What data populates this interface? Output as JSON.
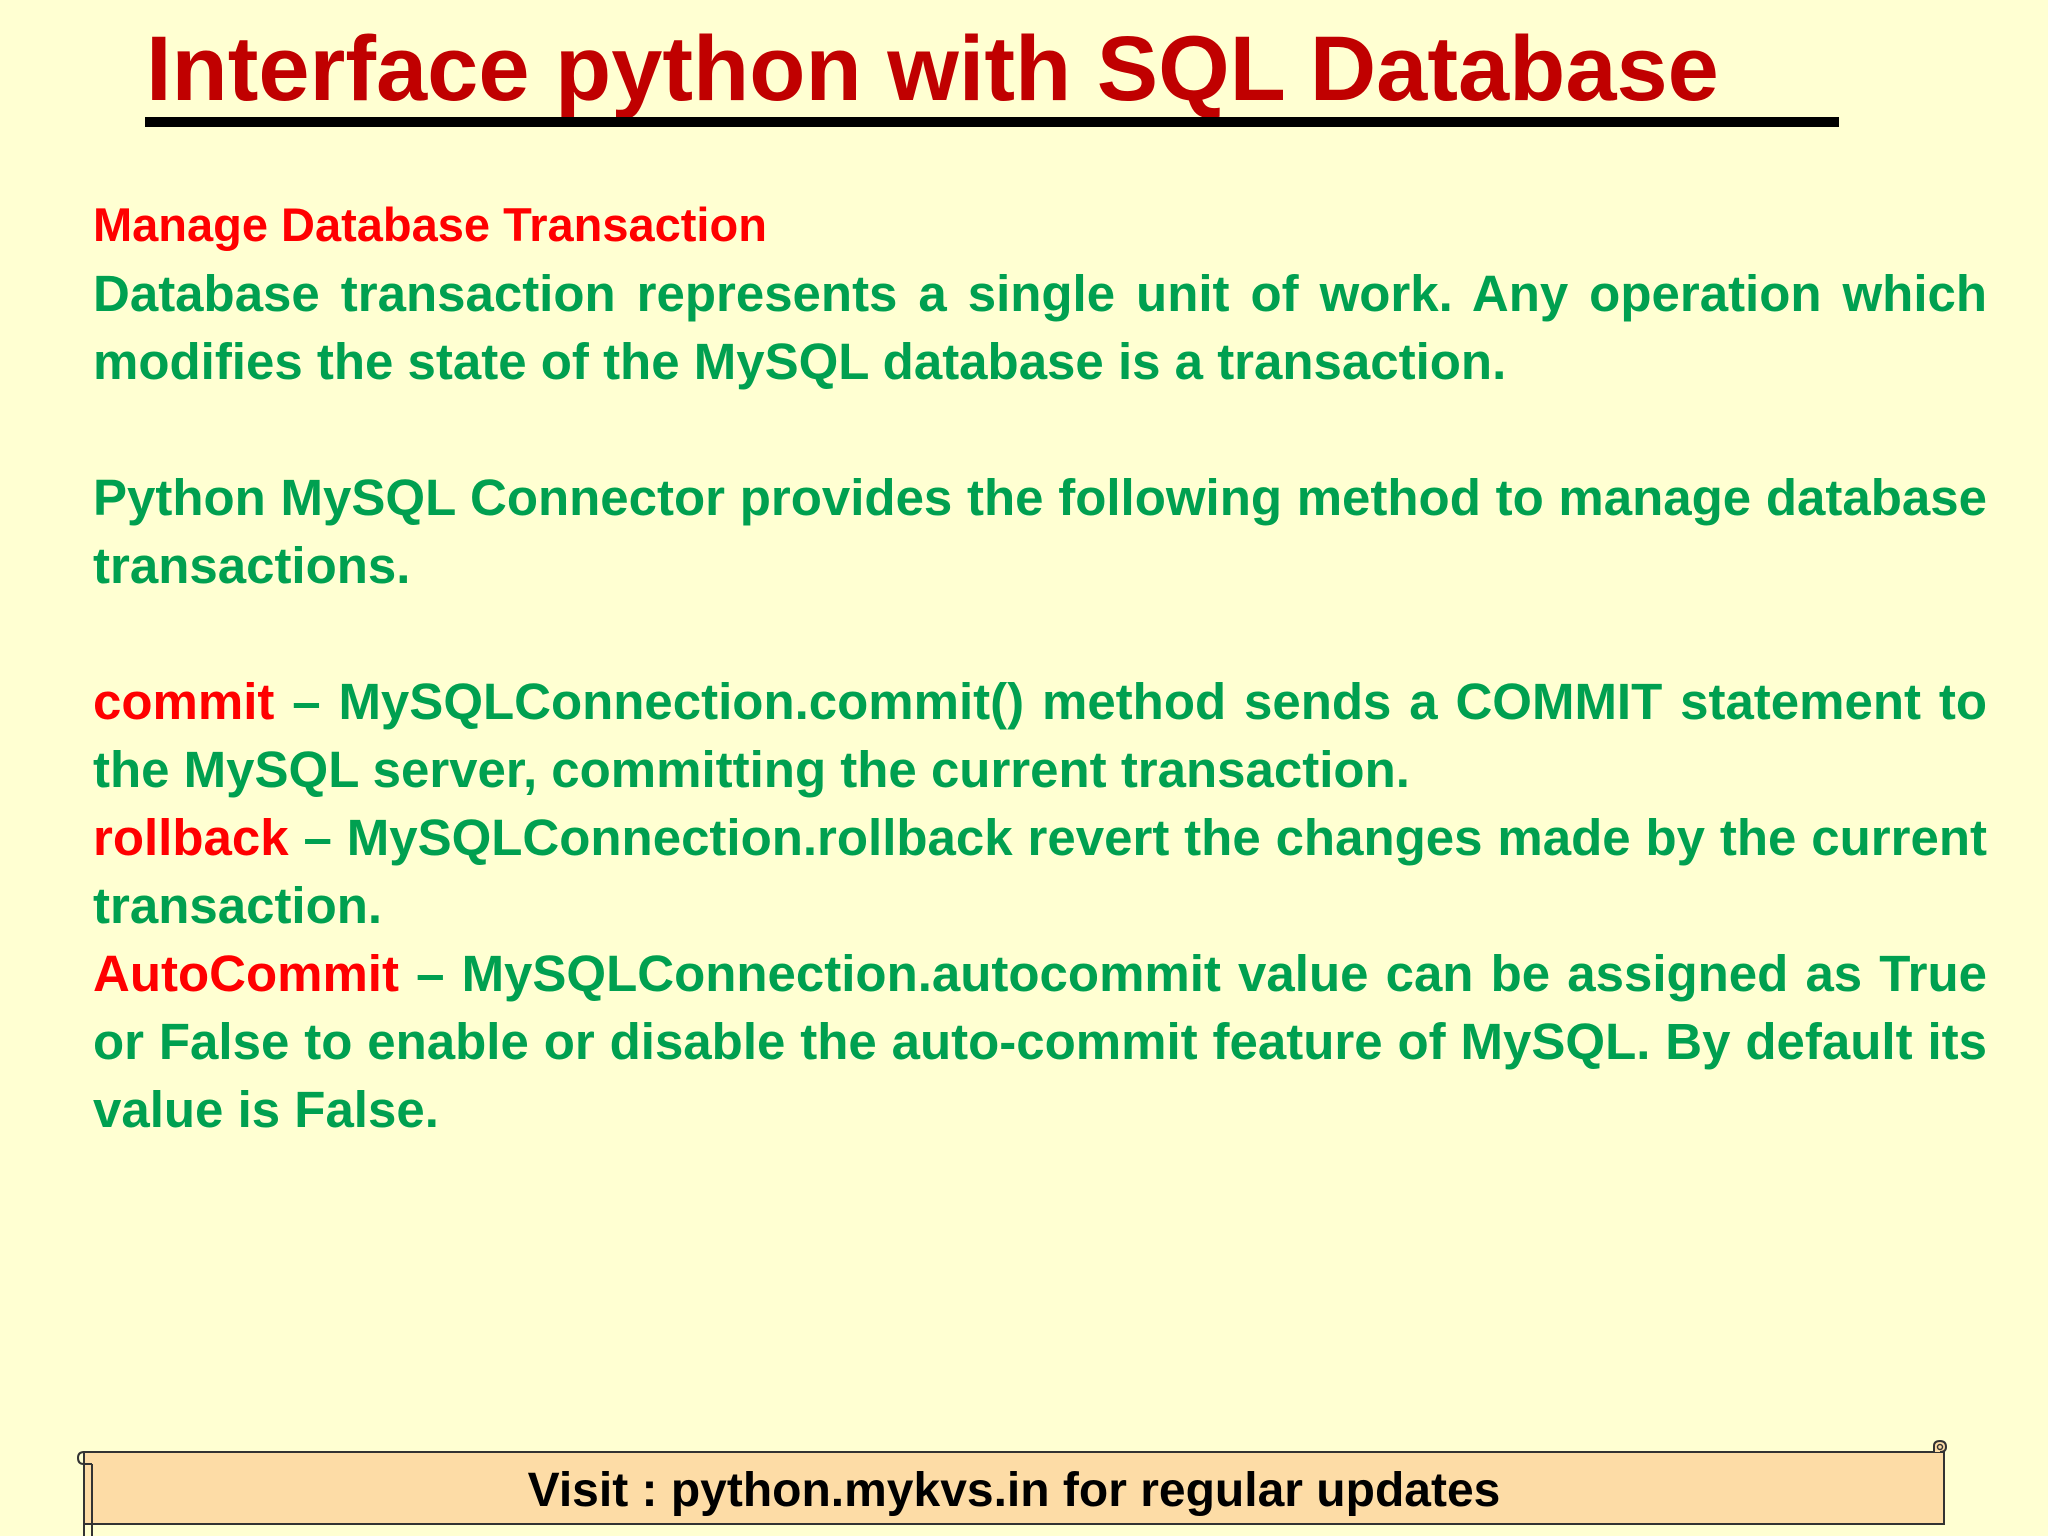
{
  "title": "Interface python with SQL Database",
  "section_heading": "Manage Database Transaction",
  "intro_paragraph": "Database transaction represents a single unit of work. Any operation which modifies the state of the MySQL database is a transaction.",
  "connector_paragraph": "Python MySQL Connector provides the following method to manage database transactions.",
  "methods": [
    {
      "term": "commit",
      "description": " – MySQLConnection.commit() method sends a COMMIT statement to the MySQL server, committing the current transaction."
    },
    {
      "term": "rollback",
      "description": " – MySQLConnection.rollback revert the changes made by the current transaction."
    },
    {
      "term": "AutoCommit",
      "description": " – MySQLConnection.autocommit value can be assigned as True or False to enable or disable the auto-commit feature of MySQL. By default its value is False."
    }
  ],
  "footer": "Visit : python.mykvs.in for regular updates",
  "colors": {
    "background": "#ffffd2",
    "title": "#c00000",
    "heading_and_terms": "#ff0000",
    "body_text": "#00a050",
    "footer_fill": "#fddca6"
  }
}
